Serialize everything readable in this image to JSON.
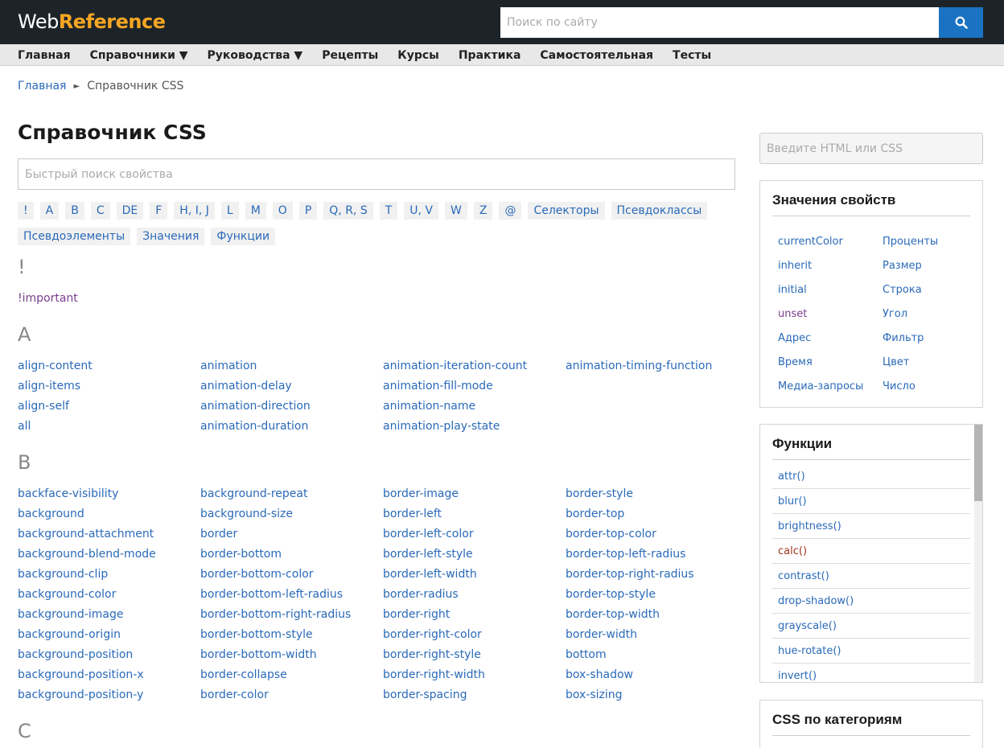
{
  "header": {
    "logo_web": "Web",
    "logo_ref": "Reference",
    "search_placeholder": "Поиск по сайту"
  },
  "nav": [
    "Главная",
    "Справочники ▼",
    "Руководства ▼",
    "Рецепты",
    "Курсы",
    "Практика",
    "Самостоятельная",
    "Тесты"
  ],
  "breadcrumb": {
    "home": "Главная",
    "separator": "►",
    "current": "Справочник CSS"
  },
  "main": {
    "title": "Справочник CSS",
    "quick_search_placeholder": "Быстрый поиск свойства",
    "letters": [
      "!",
      "A",
      "B",
      "C",
      "DE",
      "F",
      "H, I, J",
      "L",
      "M",
      "O",
      "P",
      "Q, R, S",
      "T",
      "U, V",
      "W",
      "Z",
      "@",
      "Селекторы",
      "Псевдоклассы",
      "Псевдоэлементы",
      "Значения",
      "Функции"
    ],
    "sections": [
      {
        "head": "!",
        "items": [
          "!important"
        ]
      },
      {
        "head": "A",
        "items": [
          "align-content",
          "align-items",
          "align-self",
          "all",
          "animation",
          "animation-delay",
          "animation-direction",
          "animation-duration",
          "animation-iteration-count",
          "animation-fill-mode",
          "animation-name",
          "animation-play-state",
          "animation-timing-function"
        ]
      },
      {
        "head": "B",
        "items": [
          "backface-visibility",
          "background",
          "background-attachment",
          "background-blend-mode",
          "background-clip",
          "background-color",
          "background-image",
          "background-origin",
          "background-position",
          "background-position-x",
          "background-position-y",
          "background-repeat",
          "background-size",
          "border",
          "border-bottom",
          "border-bottom-color",
          "border-bottom-left-radius",
          "border-bottom-right-radius",
          "border-bottom-style",
          "border-bottom-width",
          "border-collapse",
          "border-color",
          "border-image",
          "border-left",
          "border-left-color",
          "border-left-style",
          "border-left-width",
          "border-radius",
          "border-right",
          "border-right-color",
          "border-right-style",
          "border-right-width",
          "border-spacing",
          "border-style",
          "border-top",
          "border-top-color",
          "border-top-left-radius",
          "border-top-right-radius",
          "border-top-style",
          "border-top-width",
          "border-width",
          "bottom",
          "box-shadow",
          "box-sizing"
        ]
      },
      {
        "head": "C",
        "items": []
      }
    ]
  },
  "sidebar": {
    "search_placeholder": "Введите HTML или CSS",
    "values_box": {
      "title": "Значения свойств",
      "items": [
        "currentColor",
        "inherit",
        "initial",
        "unset",
        "Адрес",
        "Время",
        "Медиа-запросы",
        "Проценты",
        "Размер",
        "Строка",
        "Угол",
        "Фильтр",
        "Цвет",
        "Число"
      ]
    },
    "functions_box": {
      "title": "Функции",
      "items": [
        "attr()",
        "blur()",
        "brightness()",
        "calc()",
        "contrast()",
        "drop-shadow()",
        "grayscale()",
        "hue-rotate()",
        "invert()"
      ]
    },
    "categories_box": {
      "title": "CSS по категориям"
    }
  },
  "colors": {
    "link": "#2a6ab8",
    "visited": "#7a3e8e",
    "header_bg": "#1d2429",
    "logo_accent": "#f5a623",
    "search_button": "#1a73c2"
  }
}
